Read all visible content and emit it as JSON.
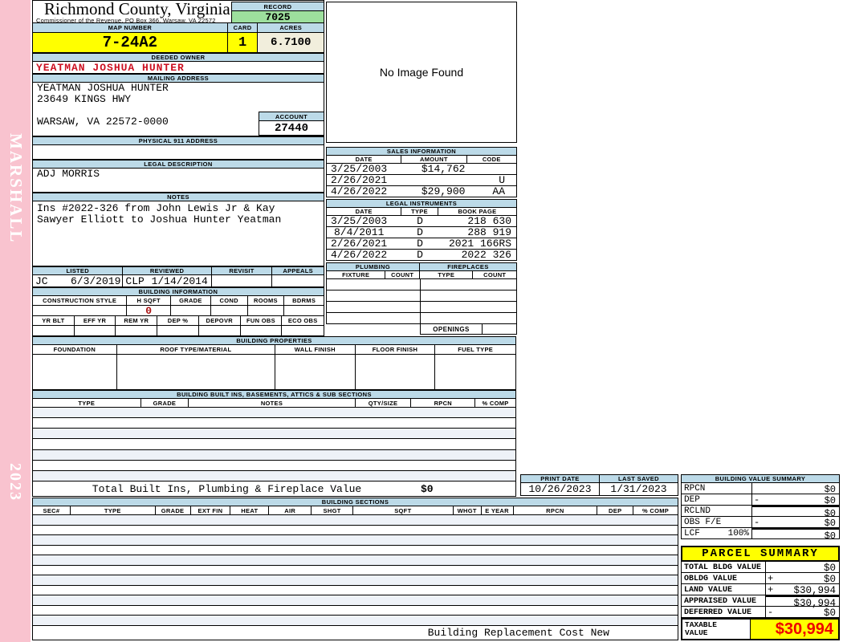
{
  "sidebar": {
    "vendor": "MARSHALL",
    "year": "2023"
  },
  "header": {
    "county": "Richmond County, Virginia",
    "subtitle": "Commissioner of the Revenue, PO Box 366, Warsaw, VA 22572",
    "record_label": "RECORD",
    "record": "7025",
    "map_number_label": "MAP NUMBER",
    "map_number": "7-24A2",
    "card_label": "CARD",
    "card": "1",
    "acres_label": "ACRES",
    "acres": "6.7100"
  },
  "owner": {
    "deeded_owner_label": "DEEDED OWNER",
    "deeded_owner": "YEATMAN JOSHUA HUNTER",
    "mailing_address_label": "MAILING ADDRESS",
    "mailing_lines": [
      "YEATMAN JOSHUA HUNTER",
      "23649 KINGS HWY",
      "",
      "WARSAW, VA 22572-0000"
    ],
    "account_label": "ACCOUNT",
    "account": "27440",
    "physical_address_label": "PHYSICAL 911 ADDRESS"
  },
  "legal": {
    "label": "LEGAL DESCRIPTION",
    "description": "ADJ MORRIS"
  },
  "notes": {
    "label": "NOTES",
    "lines": [
      "Ins #2022-326 from John Lewis Jr & Kay",
      "Sawyer Elliott to Joshua Hunter Yeatman"
    ]
  },
  "image_panel": {
    "text": "No Image Found"
  },
  "sales": {
    "label": "SALES INFORMATION",
    "headers": [
      "DATE",
      "AMOUNT",
      "CODE"
    ],
    "rows": [
      [
        "3/25/2003",
        "$14,762",
        ""
      ],
      [
        "2/26/2021",
        "",
        "U"
      ],
      [
        "4/26/2022",
        "$29,900",
        "AA"
      ]
    ]
  },
  "instruments": {
    "label": "LEGAL INSTRUMENTS",
    "headers": [
      "DATE",
      "TYPE",
      "BOOK PAGE"
    ],
    "rows": [
      [
        "3/25/2003",
        "D",
        "218 630"
      ],
      [
        "8/4/2011",
        "D",
        "288 919"
      ],
      [
        "2/26/2021",
        "D",
        "2021 166RS"
      ],
      [
        "4/26/2022",
        "D",
        "2022 326"
      ]
    ]
  },
  "plumbing": {
    "label": "PLUMBING",
    "headers": [
      "FIXTURE",
      "COUNT"
    ]
  },
  "fireplaces": {
    "label": "FIREPLACES",
    "headers": [
      "TYPE",
      "COUNT"
    ],
    "openings_label": "OPENINGS"
  },
  "review": {
    "headers": [
      "LISTED",
      "REVIEWED",
      "REVISIT",
      "APPEALS"
    ],
    "listed_by": "JC",
    "listed_date": "6/3/2019",
    "reviewed_by": "CLP",
    "reviewed_date": "1/14/2014"
  },
  "building_info": {
    "label": "BUILDING INFORMATION",
    "headers1": [
      "CONSTRUCTION STYLE",
      "H SQFT",
      "GRADE",
      "COND",
      "ROOMS",
      "BDRMS"
    ],
    "hsqft": "0",
    "headers2": [
      "YR BLT",
      "EFF YR",
      "REM YR",
      "DEP %",
      "DEPOVR",
      "FUN OBS",
      "ECO OBS"
    ]
  },
  "building_props": {
    "label": "BUILDING PROPERTIES",
    "headers": [
      "FOUNDATION",
      "ROOF TYPE/MATERIAL",
      "WALL FINISH",
      "FLOOR FINISH",
      "FUEL TYPE"
    ]
  },
  "built_ins": {
    "label": "BUILDING BUILT INS, BASEMENTS, ATTICS & SUB SECTIONS",
    "headers": [
      "TYPE",
      "GRADE",
      "NOTES",
      "QTY/SIZE",
      "RPCN",
      "% COMP"
    ],
    "total_label": "Total Built Ins, Plumbing & Fireplace Value",
    "total_value": "$0"
  },
  "print_info": {
    "print_date_label": "PRINT DATE",
    "print_date": "10/26/2023",
    "last_saved_label": "LAST SAVED",
    "last_saved": "1/31/2023"
  },
  "building_value_summary": {
    "label": "BUILDING VALUE SUMMARY",
    "rows": [
      {
        "label": "RPCN",
        "pct": "",
        "sign": "",
        "value": "$0"
      },
      {
        "label": "DEP",
        "pct": "",
        "sign": "-",
        "value": "$0"
      },
      {
        "label": "RCLND",
        "pct": "",
        "sign": "",
        "value": "$0"
      },
      {
        "label": "OBS F/E",
        "pct": "",
        "sign": "-",
        "value": "$0"
      },
      {
        "label": "LCF",
        "pct": "100%",
        "sign": "",
        "value": "$0"
      }
    ]
  },
  "building_sections": {
    "label": "BUILDING SECTIONS",
    "headers": [
      "SEC#",
      "TYPE",
      "GRADE",
      "EXT FIN",
      "HEAT",
      "AIR",
      "SHGT",
      "SQFT",
      "WHGT",
      "E YEAR",
      "RPCN",
      "DEP",
      "% COMP"
    ],
    "footer": "Building Replacement Cost New"
  },
  "parcel_summary": {
    "label": "PARCEL SUMMARY",
    "rows": [
      {
        "label": "TOTAL BLDG VALUE",
        "sign": "",
        "value": "$0"
      },
      {
        "label": "OBLDG VALUE",
        "sign": "+",
        "value": "$0"
      },
      {
        "label": "LAND VALUE",
        "sign": "+",
        "value": "$30,994"
      },
      {
        "label": "APPRAISED VALUE",
        "sign": "",
        "value": "$30,994"
      },
      {
        "label": "DEFERRED VALUE",
        "sign": "-",
        "value": "$0"
      }
    ],
    "taxable_label_1": "TAXABLE",
    "taxable_label_2": "VALUE",
    "taxable_value": "$30,994"
  },
  "colors": {
    "strip_blue": "#bcdae8",
    "record_green": "#9ddf9d",
    "highlight_yellow": "#ffff00",
    "acres_cream": "#f1eedc",
    "margin_pink": "#f9c3cf",
    "owner_red": "#cc1122",
    "taxable_red": "#ee0000"
  }
}
